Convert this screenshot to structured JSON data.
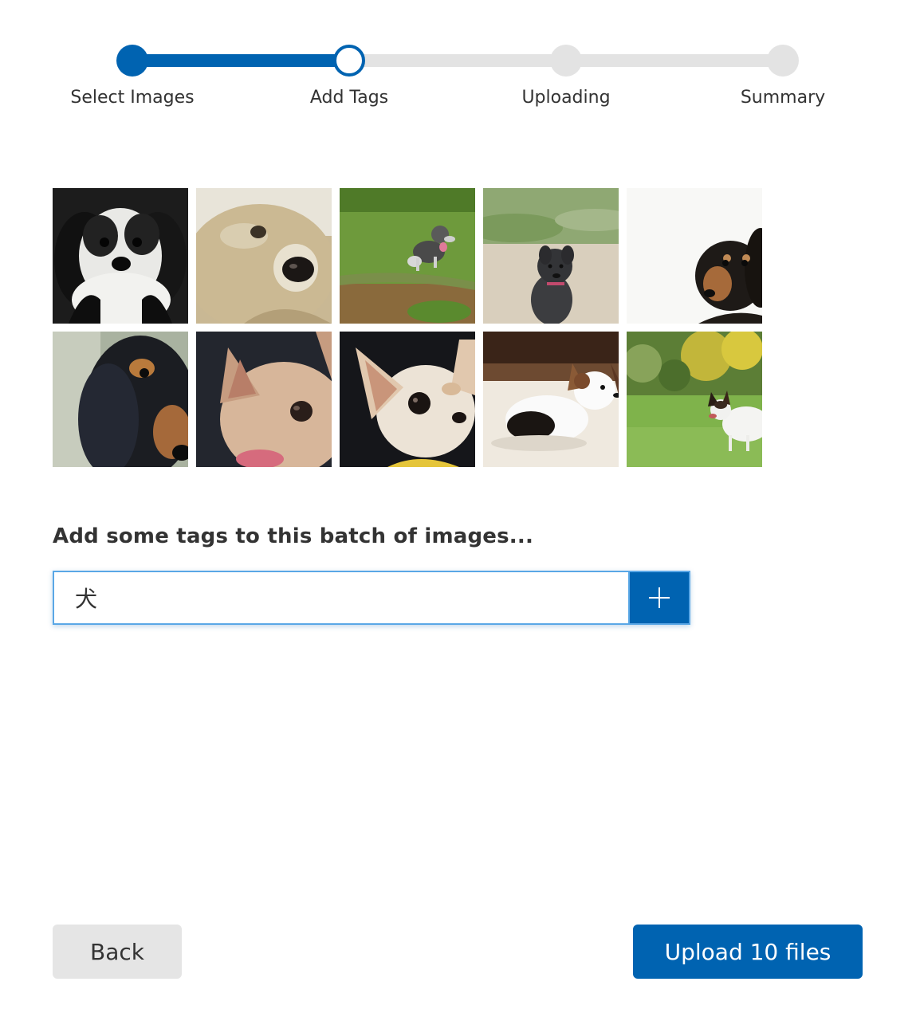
{
  "stepper": {
    "steps": [
      {
        "label": "Select Images",
        "state": "completed"
      },
      {
        "label": "Add Tags",
        "state": "current"
      },
      {
        "label": "Uploading",
        "state": "pending"
      },
      {
        "label": "Summary",
        "state": "pending"
      }
    ],
    "colors": {
      "active": "#0063b1",
      "inactive": "#e3e3e3"
    }
  },
  "images": [
    {
      "subject": "shih-tzu-black-white"
    },
    {
      "subject": "shih-tzu-closeup"
    },
    {
      "subject": "schnauzer-running-grass"
    },
    {
      "subject": "schnauzer-black-running"
    },
    {
      "subject": "dachshund-black-tan"
    },
    {
      "subject": "dachshund-closeup"
    },
    {
      "subject": "chihuahua-closeup"
    },
    {
      "subject": "chihuahua-cream"
    },
    {
      "subject": "papillon-lying"
    },
    {
      "subject": "papillon-running-grass"
    }
  ],
  "tags": {
    "heading": "Add some tags to this batch of images...",
    "input_value": "犬",
    "add_icon": "plus-icon"
  },
  "footer": {
    "back_label": "Back",
    "upload_label": "Upload 10 files"
  }
}
